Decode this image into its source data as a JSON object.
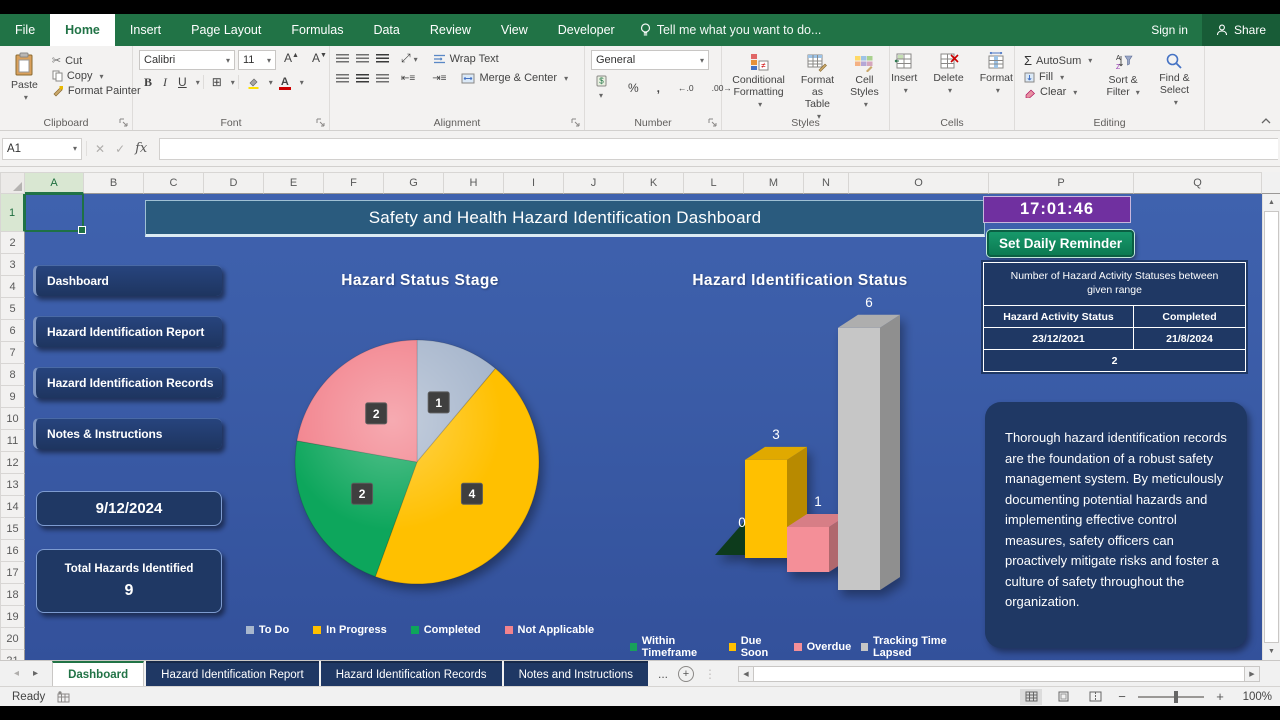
{
  "ribbon": {
    "tabs": [
      "File",
      "Home",
      "Insert",
      "Page Layout",
      "Formulas",
      "Data",
      "Review",
      "View",
      "Developer"
    ],
    "active_tab": "Home",
    "tell_me": "Tell me what you want to do...",
    "sign_in": "Sign in",
    "share": "Share",
    "groups": {
      "clipboard": {
        "label": "Clipboard",
        "paste": "Paste",
        "cut": "Cut",
        "copy": "Copy",
        "format_painter": "Format Painter"
      },
      "font": {
        "label": "Font",
        "font_name": "Calibri",
        "font_size": "11"
      },
      "alignment": {
        "label": "Alignment",
        "wrap_text": "Wrap Text",
        "merge_center": "Merge & Center"
      },
      "number": {
        "label": "Number",
        "format": "General"
      },
      "styles": {
        "label": "Styles",
        "conditional_formatting": "Conditional Formatting",
        "format_as_table": "Format as Table",
        "cell_styles": "Cell Styles"
      },
      "cells": {
        "label": "Cells",
        "insert": "Insert",
        "delete": "Delete",
        "format": "Format"
      },
      "editing": {
        "label": "Editing",
        "autosum": "AutoSum",
        "fill": "Fill",
        "clear": "Clear",
        "sort_filter": "Sort & Filter",
        "find_select": "Find & Select"
      }
    }
  },
  "formula_bar": {
    "name_box": "A1",
    "fx": "fx"
  },
  "grid": {
    "columns": [
      "A",
      "B",
      "C",
      "D",
      "E",
      "F",
      "G",
      "H",
      "I",
      "J",
      "K",
      "L",
      "M",
      "N",
      "O",
      "P",
      "Q"
    ]
  },
  "dashboard": {
    "title": "Safety and Health Hazard Identification Dashboard",
    "clock": "17:01:46",
    "reminder_button": "Set Daily Reminder",
    "nav_buttons": [
      "Dashboard",
      "Hazard Identification Report",
      "Hazard Identification Records",
      "Notes & Instructions"
    ],
    "date": "9/12/2024",
    "total_label": "Total Hazards Identified",
    "total_value": "9",
    "range_table": {
      "header": "Number of Hazard Activity Statuses between given range",
      "col1": "Hazard Activity Status",
      "col2": "Completed",
      "val1": "23/12/2021",
      "val2": "21/8/2024",
      "result": "2"
    },
    "note": "Thorough hazard identification records are the foundation of a robust safety management system. By meticulously documenting potential hazards and implementing effective control measures, safety officers can proactively mitigate risks and foster a culture of safety throughout the organization.",
    "colors": {
      "canvas_blue": "#3a5ba6",
      "navy_box": "#1f3864",
      "banner_blue": "#2a5b7e",
      "clock_purple": "#7030a0",
      "reminder_green": "#0f8a5f",
      "excel_green": "#217346"
    }
  },
  "chart_data": [
    {
      "type": "pie",
      "title": "Hazard Status Stage",
      "categories": [
        "To Do",
        "In Progress",
        "Completed",
        "Not Applicable"
      ],
      "values": [
        1,
        4,
        2,
        2
      ],
      "colors": [
        "#a8b7cd",
        "#ffc000",
        "#0ea65b",
        "#f2838d"
      ],
      "data_labels": [
        1,
        4,
        2,
        2
      ],
      "legend_position": "bottom",
      "start_angle_deg": 0,
      "total": 9
    },
    {
      "type": "bar",
      "title": "Hazard Identification Status",
      "categories": [
        "Within Timeframe",
        "Due Soon",
        "Overdue",
        "Tracking Time Lapsed"
      ],
      "values": [
        0,
        3,
        1,
        6
      ],
      "colors": [
        "#18a05a",
        "#ffc000",
        "#f48f98",
        "#c6c6c6"
      ],
      "data_labels": [
        0,
        3,
        1,
        6
      ],
      "legend_position": "bottom",
      "ylim": [
        0,
        6
      ],
      "style": "3d-column"
    }
  ],
  "sheet_tabs": {
    "items": [
      "Dashboard",
      "Hazard Identification Report",
      "Hazard Identification Records",
      "Notes and Instructions"
    ],
    "active": "Dashboard",
    "overflow": "..."
  },
  "status_bar": {
    "ready": "Ready",
    "zoom": "100%"
  }
}
